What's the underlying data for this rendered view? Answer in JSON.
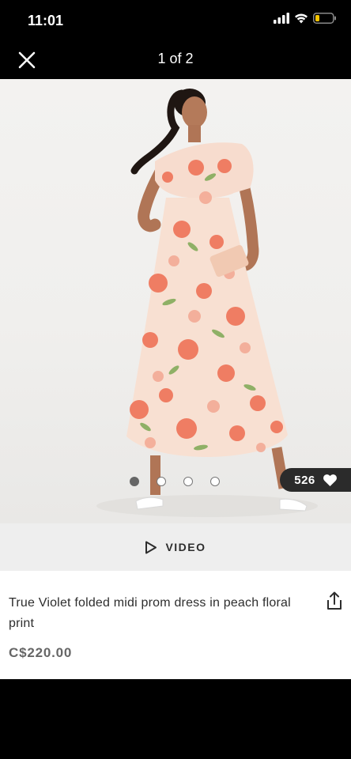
{
  "status_bar": {
    "time": "11:01",
    "icons": [
      "cellular-signal-icon",
      "wifi-icon",
      "battery-low-icon"
    ],
    "battery_color": "#f5c400"
  },
  "nav": {
    "title": "1 of 2",
    "close_icon": "close-icon"
  },
  "gallery": {
    "image_description_icon": "product-photo",
    "dots_count": 4,
    "active_dot": 0,
    "likes": "526",
    "likes_icon": "heart-icon"
  },
  "video": {
    "label": "VIDEO",
    "icon": "play-icon"
  },
  "product": {
    "title": "True Violet folded midi prom dress in peach floral print",
    "price": "C$220.00",
    "share_icon": "share-icon"
  }
}
